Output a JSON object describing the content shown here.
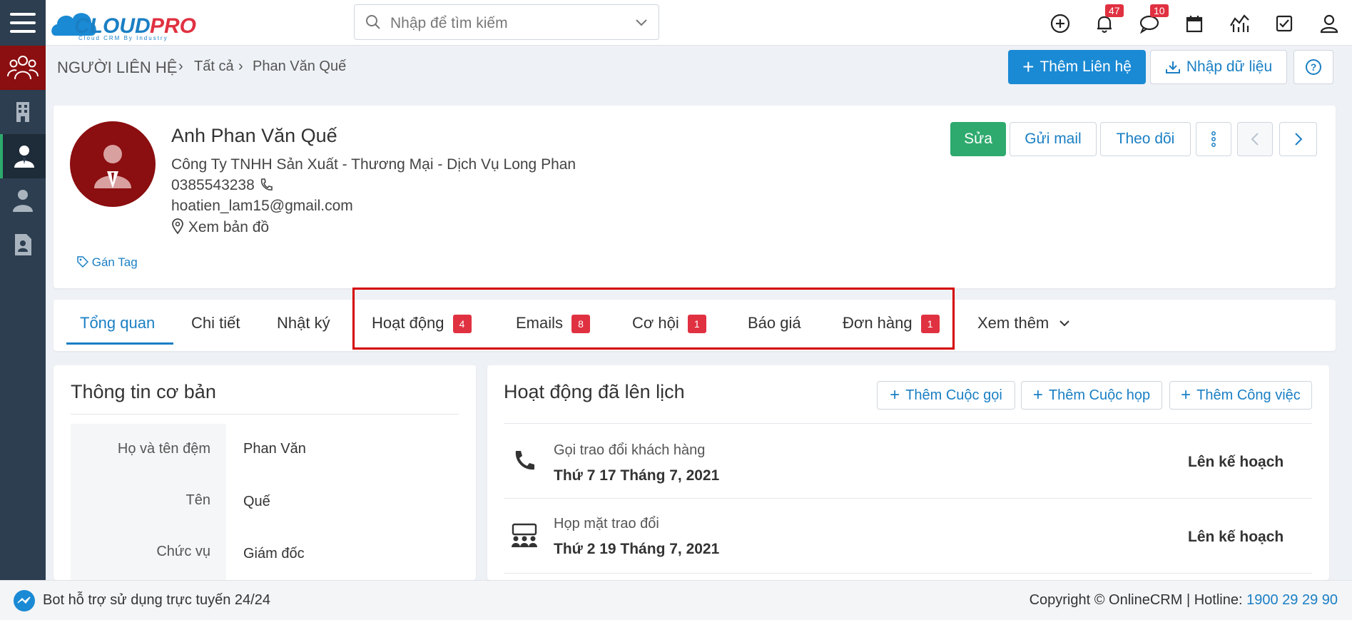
{
  "app": {
    "logo_text": "CLOUDPRO",
    "logo_sub": "Cloud CRM By Industry"
  },
  "search": {
    "placeholder": "Nhập để tìm kiếm"
  },
  "topbar": {
    "notifications_count": "47",
    "messages_count": "10"
  },
  "breadcrumb": {
    "module": "NGƯỜI LIÊN HỆ",
    "level1": "Tất cả",
    "current": "Phan Văn Quế"
  },
  "header_actions": {
    "add_contact": "Thêm Liên hệ",
    "import": "Nhập dữ liệu"
  },
  "profile": {
    "name": "Anh Phan Văn Quế",
    "company": "Công Ty TNHH Sản Xuất - Thương Mại - Dịch Vụ Long Phan",
    "phone": "0385543238",
    "email": "hoatien_lam15@gmail.com",
    "map_link": "Xem bản đồ",
    "tag_label": "Gán Tag",
    "edit": "Sửa",
    "send_mail": "Gửi mail",
    "follow": "Theo dõi"
  },
  "tabs": [
    {
      "label": "Tổng quan"
    },
    {
      "label": "Chi tiết"
    },
    {
      "label": "Nhật ký"
    },
    {
      "label": "Hoạt động",
      "count": "4"
    },
    {
      "label": "Emails",
      "count": "8"
    },
    {
      "label": "Cơ hội",
      "count": "1"
    },
    {
      "label": "Báo giá"
    },
    {
      "label": "Đơn hàng",
      "count": "1"
    },
    {
      "label": "Xem thêm"
    }
  ],
  "basic_info": {
    "title": "Thông tin cơ bản",
    "rows": [
      {
        "label": "Họ và tên đệm",
        "value": "Phan Văn"
      },
      {
        "label": "Tên",
        "value": "Quế"
      },
      {
        "label": "Chức vụ",
        "value": "Giám đốc"
      }
    ]
  },
  "activities": {
    "title": "Hoạt động đã lên lịch",
    "add_call": "Thêm Cuộc gọi",
    "add_meeting": "Thêm Cuộc họp",
    "add_task": "Thêm Công việc",
    "items": [
      {
        "title": "Gọi trao đổi khách hàng",
        "date": "Thứ 7 17 Tháng 7, 2021",
        "status": "Lên kế hoạch",
        "icon": "phone-icon"
      },
      {
        "title": "Họp mặt trao đổi",
        "date": "Thứ 2 19 Tháng 7, 2021",
        "status": "Lên kế hoạch",
        "icon": "meeting-icon"
      }
    ]
  },
  "footer": {
    "bot_text": "Bot hỗ trợ sử dụng trực tuyến 24/24",
    "copyright": "Copyright © OnlineCRM",
    "hotline_label": "Hotline:",
    "hotline": "1900 29 29 90"
  },
  "colors": {
    "primary": "#1a8ad4",
    "sidebar": "#2c3e50",
    "active_sidebar": "#8b0e10",
    "success": "#2eaa6e",
    "badge": "#e03141",
    "highlight_box": "#d40000"
  }
}
